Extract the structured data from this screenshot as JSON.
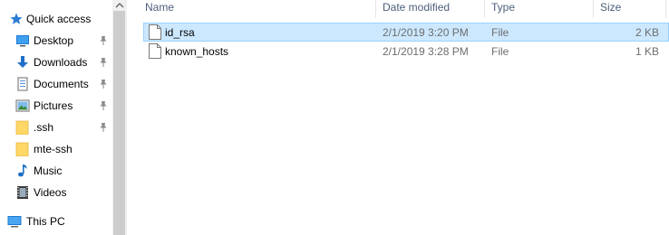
{
  "nav": {
    "quick_access": "Quick access",
    "items": [
      {
        "label": "Desktop",
        "pinned": true
      },
      {
        "label": "Downloads",
        "pinned": true
      },
      {
        "label": "Documents",
        "pinned": true
      },
      {
        "label": "Pictures",
        "pinned": true
      },
      {
        "label": ".ssh",
        "pinned": true
      },
      {
        "label": "mte-ssh",
        "pinned": false
      },
      {
        "label": "Music",
        "pinned": false
      },
      {
        "label": "Videos",
        "pinned": false
      }
    ],
    "this_pc": "This PC"
  },
  "columns": {
    "name": "Name",
    "date_modified": "Date modified",
    "type": "Type",
    "size": "Size"
  },
  "files": [
    {
      "name": "id_rsa",
      "date": "2/1/2019 3:20 PM",
      "type": "File",
      "size": "2 KB",
      "selected": true
    },
    {
      "name": "known_hosts",
      "date": "2/1/2019 3:28 PM",
      "type": "File",
      "size": "1 KB",
      "selected": false
    }
  ],
  "colors": {
    "selection_bg": "#cce8ff",
    "selection_border": "#99d1ff",
    "header_text": "#4c607a",
    "quick_access_star": "#2b7cd3",
    "folder_yellow": "#ffd766"
  }
}
